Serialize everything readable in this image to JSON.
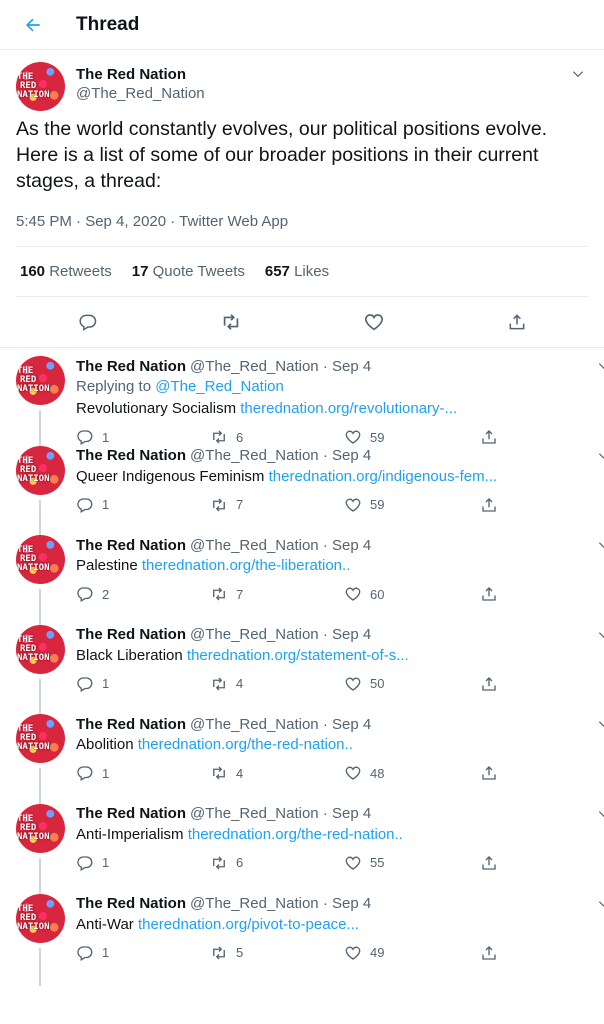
{
  "header": {
    "title": "Thread"
  },
  "main": {
    "display_name": "The Red Nation",
    "handle": "@The_Red_Nation",
    "avatar_text": [
      "THE",
      "RED",
      "NATION"
    ],
    "text": "As the world constantly evolves, our political positions evolve. Here is a list of some of our broader positions in their current stages, a thread:",
    "meta": "5:45 PM · Sep 4, 2020 · Twitter Web App",
    "stats": {
      "retweets_count": "160",
      "retweets_label": "Retweets",
      "quotes_count": "17",
      "quotes_label": "Quote Tweets",
      "likes_count": "657",
      "likes_label": "Likes"
    }
  },
  "replies": [
    {
      "display_name": "The Red Nation",
      "handle": "@The_Red_Nation · Sep 4",
      "replying_label": "Replying to",
      "replying_to": "@The_Red_Nation",
      "text": "Revolutionary Socialism",
      "link": "therednation.org/revolutionary-...",
      "replies": "1",
      "retweets": "6",
      "likes": "59"
    },
    {
      "display_name": "The Red Nation",
      "handle": "@The_Red_Nation · Sep 4",
      "text": "Queer Indigenous Feminism",
      "link": "therednation.org/indigenous-fem...",
      "replies": "1",
      "retweets": "7",
      "likes": "59"
    },
    {
      "display_name": "The Red Nation",
      "handle": "@The_Red_Nation · Sep 4",
      "text": "Palestine",
      "link": "therednation.org/the-liberation..",
      "replies": "2",
      "retweets": "7",
      "likes": "60"
    },
    {
      "display_name": "The Red Nation",
      "handle": "@The_Red_Nation · Sep 4",
      "text": "Black Liberation",
      "link": "therednation.org/statement-of-s...",
      "replies": "1",
      "retweets": "4",
      "likes": "50"
    },
    {
      "display_name": "The Red Nation",
      "handle": "@The_Red_Nation · Sep 4",
      "text": "Abolition",
      "link": "therednation.org/the-red-nation..",
      "replies": "1",
      "retweets": "4",
      "likes": "48"
    },
    {
      "display_name": "The Red Nation",
      "handle": "@The_Red_Nation · Sep 4",
      "text": "Anti-Imperialism",
      "link": "therednation.org/the-red-nation..",
      "replies": "1",
      "retweets": "6",
      "likes": "55"
    },
    {
      "display_name": "The Red Nation",
      "handle": "@The_Red_Nation · Sep 4",
      "text": "Anti-War",
      "link": "therednation.org/pivot-to-peace...",
      "replies": "1",
      "retweets": "5",
      "likes": "49"
    }
  ],
  "icons": {
    "back": "arrow-left-icon",
    "menu": "chevron-down-icon",
    "reply": "speech-bubble-icon",
    "retweet": "retweet-icon",
    "like": "heart-icon",
    "share": "share-icon"
  },
  "colors": {
    "accent": "#1da1f2",
    "text": "#0f1419",
    "secondary": "#536471",
    "border": "#e6ecf0"
  }
}
